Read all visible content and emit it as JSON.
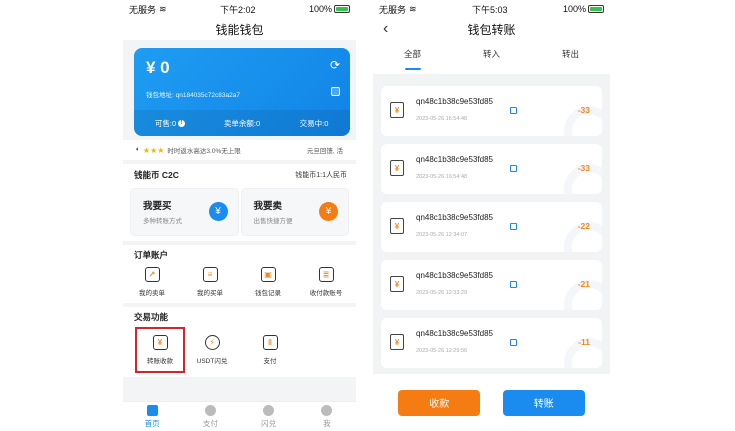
{
  "left": {
    "status": {
      "carrier": "无服务",
      "time": "下午2:02",
      "battery": "100%"
    },
    "title": "钱能钱包",
    "card": {
      "balance": "¥ 0",
      "address": "钱包地址: qn184035c72c83a2a7",
      "foot": [
        {
          "label": "可售:0"
        },
        {
          "label": "卖单余额:0"
        },
        {
          "label": "交易中:0"
        }
      ]
    },
    "notice": {
      "text": "时时返水高达3.0%无上限",
      "right": "元旦回馈, 活"
    },
    "c2c": {
      "title": "钱能币 C2C",
      "rate": "钱能币1:1人民币",
      "buy": {
        "title": "我要买",
        "sub": "多种转账方式"
      },
      "sell": {
        "title": "我要卖",
        "sub": "出售快捷方便"
      }
    },
    "orders": {
      "title": "订单账户",
      "items": [
        "我的卖单",
        "我的买单",
        "钱包记录",
        "收付款账号"
      ]
    },
    "trade": {
      "title": "交易功能",
      "items": [
        "转账收款",
        "USDT闪兑",
        "支付"
      ]
    },
    "tabs": [
      "首页",
      "支付",
      "闪兑",
      "我"
    ]
  },
  "right": {
    "status": {
      "carrier": "无服务",
      "time": "下午5:03",
      "battery": "100%"
    },
    "title": "钱包转账",
    "tabs": [
      "全部",
      "转入",
      "转出"
    ],
    "transactions": [
      {
        "address": "qn48c1b38c9e53fd85",
        "time": "2023-05-26 16:54:48",
        "amount": "-33"
      },
      {
        "address": "qn48c1b38c9e53fd85",
        "time": "2023-05-26 16:54:48",
        "amount": "-33"
      },
      {
        "address": "qn48c1b38c9e53fd85",
        "time": "2023-05-26 12:34:07",
        "amount": "-22"
      },
      {
        "address": "qn48c1b38c9e53fd85",
        "time": "2023-05-26 12:33:29",
        "amount": "-21"
      },
      {
        "address": "qn48c1b38c9e53fd85",
        "time": "2023-05-26 12:29:56",
        "amount": "-11"
      }
    ],
    "receive_label": "收款",
    "transfer_label": "转账"
  },
  "colors": {
    "accent": "#1a8cf0",
    "orange": "#f57c13",
    "highlight": "#d6242c"
  }
}
